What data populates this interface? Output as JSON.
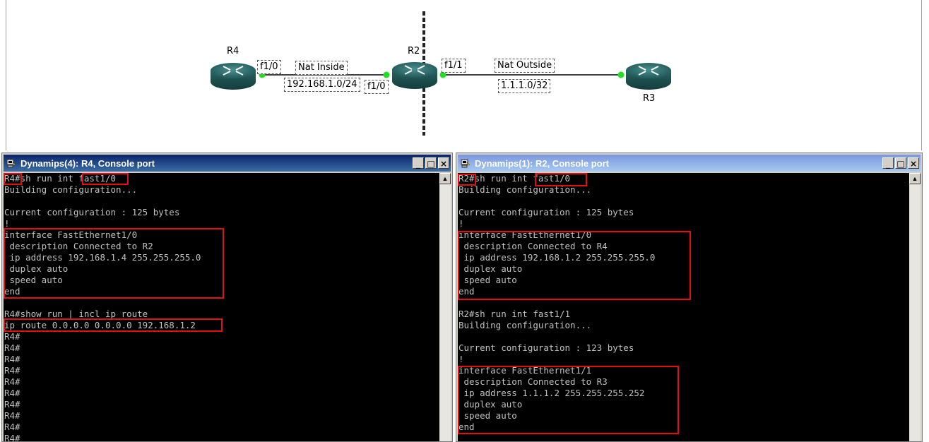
{
  "topology": {
    "routers": [
      {
        "id": "R4",
        "label": "R4"
      },
      {
        "id": "R2",
        "label": "R2"
      },
      {
        "id": "R3",
        "label": "R3"
      }
    ],
    "labels": {
      "r4_f1_0": "f1/0",
      "nat_inside": "Nat Inside",
      "inside_net": "192.168.1.0/24",
      "r2_f1_0": "f1/0",
      "r2_f1_1": "f1/1",
      "nat_outside": "Nat Outside",
      "outside_net": "1.1.1.0/32"
    }
  },
  "windows": [
    {
      "title": "Dynamips(4): R4, Console port",
      "lines": [
        "R4#sh run int fast1/0",
        "Building configuration...",
        "",
        "Current configuration : 125 bytes",
        "!",
        "interface FastEthernet1/0",
        " description Connected to R2",
        " ip address 192.168.1.4 255.255.255.0",
        " duplex auto",
        " speed auto",
        "end",
        "",
        "R4#show run | incl ip route",
        "ip route 0.0.0.0 0.0.0.0 192.168.1.2",
        "R4#",
        "R4#",
        "R4#",
        "R4#",
        "R4#",
        "R4#",
        "R4#",
        "R4#",
        "R4#",
        "R4#"
      ]
    },
    {
      "title": "Dynamips(1): R2, Console port",
      "lines": [
        "R2#sh run int fast1/0",
        "Building configuration...",
        "",
        "Current configuration : 125 bytes",
        "!",
        "interface FastEthernet1/0",
        " description Connected to R4",
        " ip address 192.168.1.2 255.255.255.0",
        " duplex auto",
        " speed auto",
        "end",
        "",
        "R2#sh run int fast1/1",
        "Building configuration...",
        "",
        "Current configuration : 123 bytes",
        "!",
        "interface FastEthernet1/1",
        " description Connected to R3",
        " ip address 1.1.1.2 255.255.255.252",
        " duplex auto",
        " speed auto",
        "end"
      ]
    }
  ],
  "window_controls": {
    "minimize": "_",
    "maximize": "□",
    "close": "×"
  },
  "colors": {
    "highlight": "#e01010",
    "console_bg": "#000000",
    "console_text": "#c0c0c0",
    "router": "#2f6b6b",
    "link_dot": "#22dd22"
  }
}
